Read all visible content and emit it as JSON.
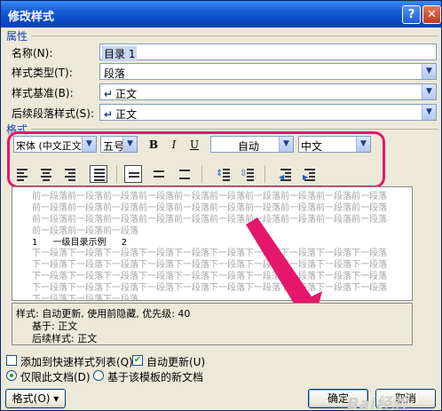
{
  "window": {
    "title": "修改样式",
    "help_glyph": "?",
    "close_glyph": "✕"
  },
  "properties": {
    "section_label": "属性",
    "name_label": "名称(N):",
    "name_value": "目录 1",
    "type_label": "样式类型(T):",
    "type_value": "段落",
    "based_label": "样式基准(B):",
    "based_value": "正文",
    "next_label": "后续段落样式(S):",
    "next_value": "正文",
    "paragraph_icon": "↵"
  },
  "format": {
    "section_label": "格式",
    "font_value": "宋体 (中文正文)",
    "size_value": "五号",
    "bold": "B",
    "italic": "I",
    "underline": "U",
    "color_value": "自动",
    "lang_value": "中文",
    "alignment_icons": [
      "align-left-icon",
      "align-center-icon",
      "align-right-icon",
      "align-justify-icon"
    ],
    "accent_color": "#e5176c"
  },
  "preview": {
    "prev_lines": [
      "前一段落前一段落前一段落前一段落前一段落前一段落前一段落前一段落前一段落前一段落",
      "前一段落前一段落前一段落前一段落前一段落前一段落前一段落前一段落前一段落前一段落",
      "前一段落前一段落前一段落前一段落前一段落前一段落前一段落前一段落前一段落前一段落",
      "前一段落前一段落前一段落"
    ],
    "sample_number": "1",
    "sample_text": "一级目录示例",
    "sample_page": "2",
    "next_lines": [
      "下一段落下一段落下一段落下一段落下一段落下一段落下一段落下一段落下一段落下一段落",
      "下一段落下一段落下一段落下一段落下一段落下一段落下一段落下一段落下一段落下一段落",
      "下一段落下一段落下一段落下一段落下一段落下一段落下一段落下一段落下一段落下一段落",
      "下一段落下一段落下一段落下一段落下一段落下一段落下一段落下一段落下一段落下一段落",
      "下一段落下一段落下一段落"
    ]
  },
  "description": {
    "line1": "样式: 自动更新, 使用前隐藏, 优先级: 40",
    "line2": "基于: 正文",
    "line3": "后续样式: 正文"
  },
  "options": {
    "add_quick_label": "添加到快速样式列表(Q)",
    "add_quick_checked": false,
    "auto_update_label": "自动更新(U)",
    "auto_update_checked": true,
    "this_doc_label": "仅限此文档(D)",
    "this_doc_selected": true,
    "template_label": "基于该模板的新文档",
    "template_selected": false
  },
  "buttons": {
    "format_label": "格式(O) ▾",
    "ok_label": "确定",
    "cancel_label": "取消"
  },
  "watermark": "Bai经验"
}
